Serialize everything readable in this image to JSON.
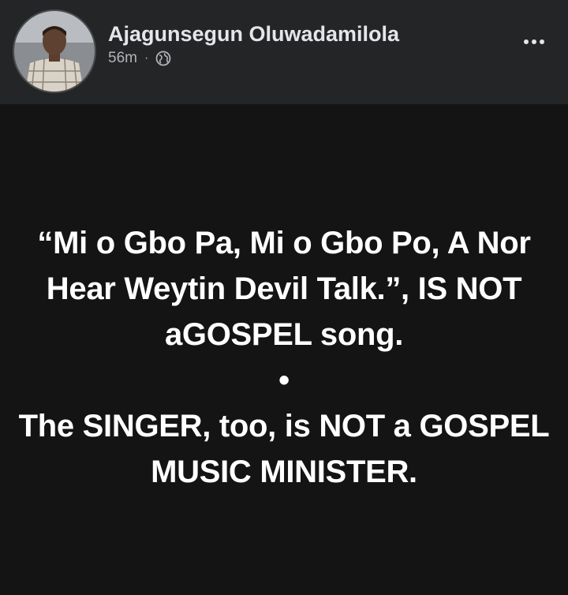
{
  "post": {
    "author": "Ajagunsegun Oluwadamilola",
    "timestamp": "56m",
    "separator": "·",
    "audience_icon": "globe-icon",
    "more_icon": "more-options-icon",
    "text_lines": [
      "“Mi o Gbo Pa, Mi o Gbo Po, A Nor",
      "Hear Weytin Devil Talk.”, IS NOT",
      "aGOSPEL song.",
      "•",
      "The SINGER, too, is NOT a GOSPEL",
      "MUSIC MINISTER."
    ]
  },
  "colors": {
    "header_bg": "#242526",
    "post_bg": "#141415",
    "name_text": "#e4e6eb",
    "meta_text": "#b0b3b8",
    "post_text": "#ffffff"
  }
}
